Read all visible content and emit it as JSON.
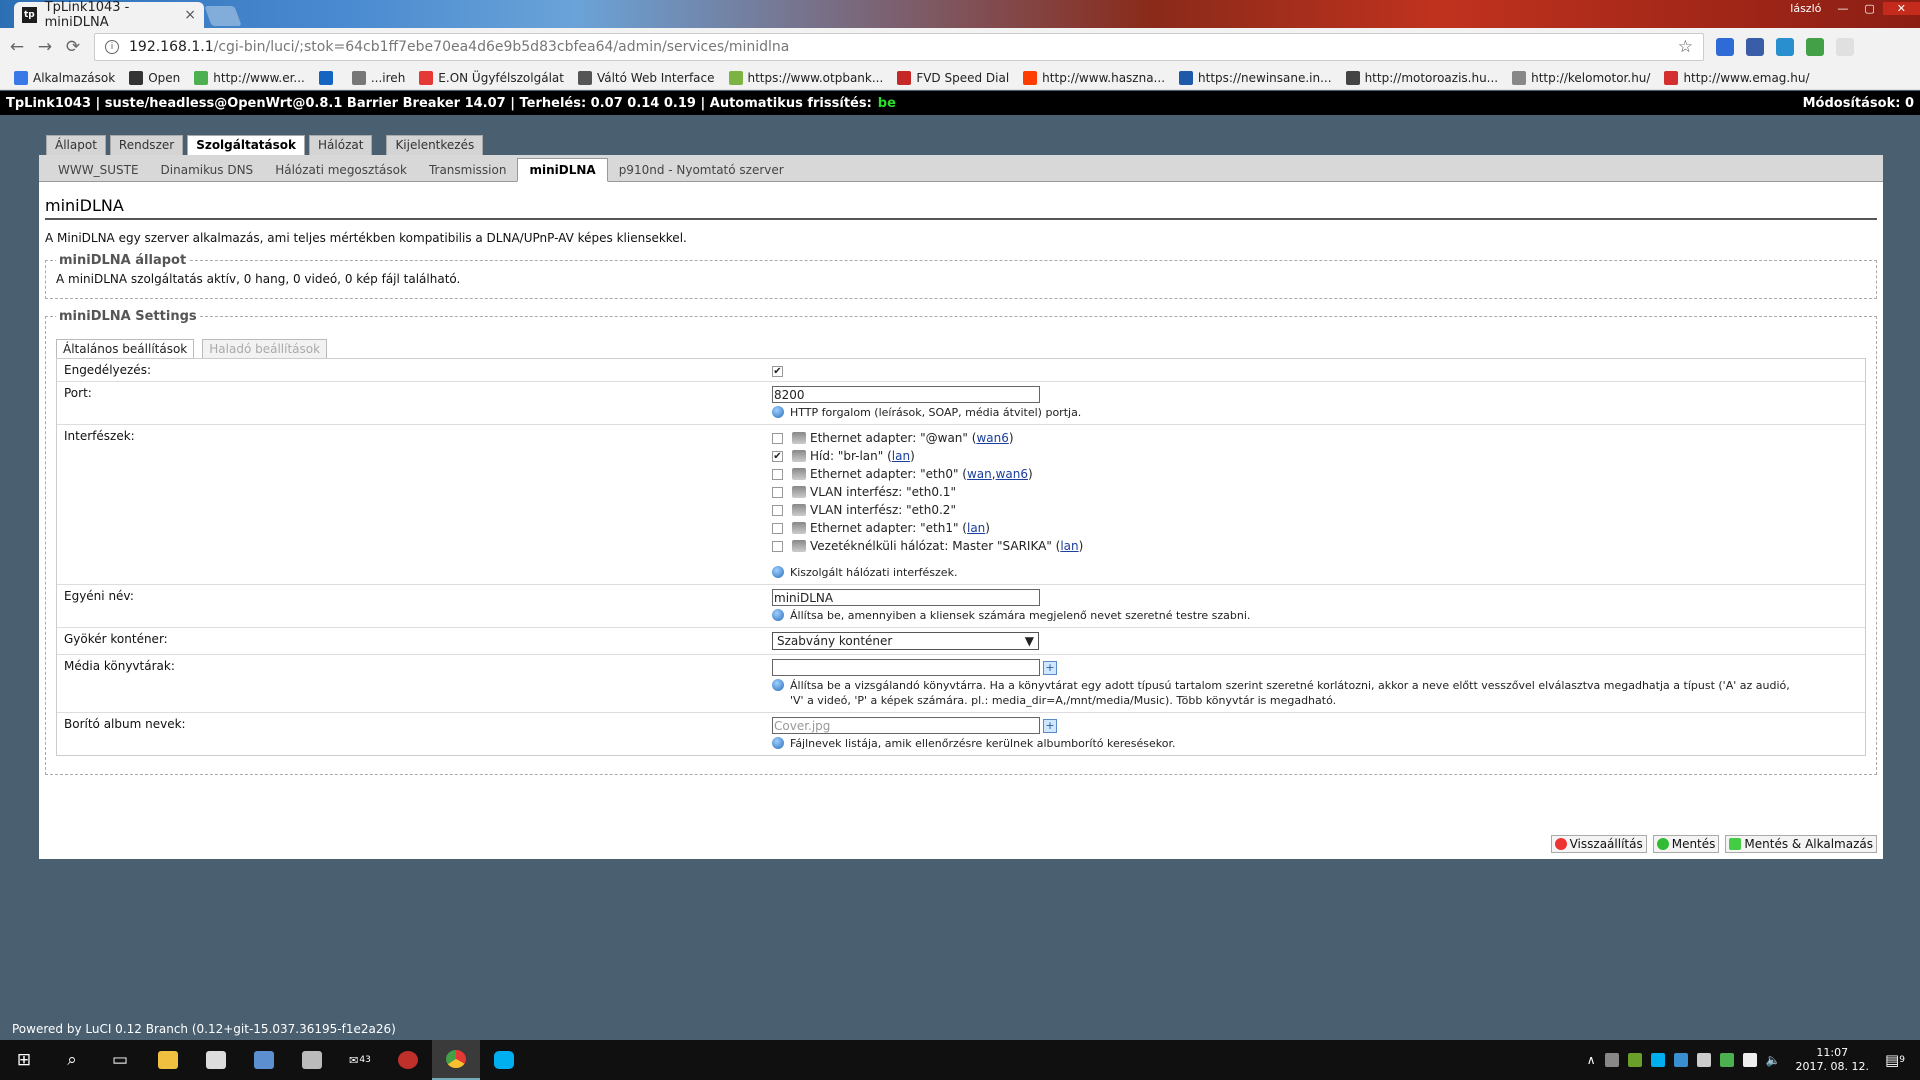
{
  "browser": {
    "tab_title": "TpLink1043 - miniDLNA",
    "tab_close": "×",
    "user_name": "lászló",
    "url_host": "192.168.1.1",
    "url_path": "/cgi-bin/luci/;stok=64cb1ff7ebe70ea4d6e9b5d83cbfea64/admin/services/minidlna",
    "star": "☆",
    "back": "←",
    "forward": "→",
    "reload": "⟳",
    "info": "i",
    "minimize": "—",
    "maximize": "▢",
    "close": "✕",
    "bookmarks": [
      {
        "label": "Alkalmazások",
        "color": "#3b78e7"
      },
      {
        "label": "Open",
        "color": "#333333"
      },
      {
        "label": "http://www.er...",
        "color": "#4caf50"
      },
      {
        "label": "",
        "color": "#1565c0"
      },
      {
        "label": "...ireh",
        "color": "#777777"
      },
      {
        "label": "E.ON Ügyfélszolgálat",
        "color": "#e53935"
      },
      {
        "label": "Váltó Web Interface",
        "color": "#555555"
      },
      {
        "label": "https://www.otpbank...",
        "color": "#7cb342"
      },
      {
        "label": "FVD Speed Dial",
        "color": "#c62828"
      },
      {
        "label": "http://www.haszna...",
        "color": "#ff3d00"
      },
      {
        "label": "https://newinsane.in...",
        "color": "#1e5aa8"
      },
      {
        "label": "http://motoroazis.hu...",
        "color": "#444444"
      },
      {
        "label": "http://kelomotor.hu/",
        "color": "#888888"
      },
      {
        "label": "http://www.emag.hu/",
        "color": "#d32f2f"
      }
    ]
  },
  "status_bar": {
    "text": "TpLink1043 | suste/headless@OpenWrt@0.8.1 Barrier Breaker 14.07 | Terhelés: 0.07 0.14 0.19 | Automatikus frissítés:",
    "refresh_state": "be",
    "changes": "Módosítások: 0"
  },
  "main_tabs": [
    "Állapot",
    "Rendszer",
    "Szolgáltatások",
    "Hálózat",
    "Kijelentkezés"
  ],
  "sub_tabs": [
    "WWW_SUSTE",
    "Dinamikus DNS",
    "Hálózati megosztások",
    "Transmission",
    "miniDLNA",
    "p910nd - Nyomtató szerver"
  ],
  "page": {
    "title": "miniDLNA",
    "description": "A MiniDLNA egy szerver alkalmazás, ami teljes mértékben kompatibilis a DLNA/UPnP-AV képes kliensekkel.",
    "status_legend": "miniDLNA állapot",
    "status_text": "A miniDLNA szolgáltatás aktív, 0 hang, 0 videó, 0 kép fájl található.",
    "settings_legend": "miniDLNA Settings",
    "tab_general": "Általános beállítások",
    "tab_advanced": "Haladó beállítások"
  },
  "form": {
    "enable_label": "Engedélyezés:",
    "enable_checked": true,
    "port_label": "Port:",
    "port_value": "8200",
    "port_hint": "HTTP forgalom (leírások, SOAP, média átvitel) portja.",
    "interfaces_label": "Interfészek:",
    "interfaces": [
      {
        "checked": false,
        "text": "Ethernet adapter: \"@wan\" (",
        "links": [
          "wan6"
        ],
        "tail": ")"
      },
      {
        "checked": true,
        "text": "Híd: \"br-lan\" (",
        "links": [
          "lan"
        ],
        "tail": ")"
      },
      {
        "checked": false,
        "text": "Ethernet adapter: \"eth0\" (",
        "links": [
          "wan",
          "wan6"
        ],
        "tail": ")"
      },
      {
        "checked": false,
        "text": "VLAN interfész: \"eth0.1\"",
        "links": [],
        "tail": ""
      },
      {
        "checked": false,
        "text": "VLAN interfész: \"eth0.2\"",
        "links": [],
        "tail": ""
      },
      {
        "checked": false,
        "text": "Ethernet adapter: \"eth1\" (",
        "links": [
          "lan"
        ],
        "tail": ")"
      },
      {
        "checked": false,
        "text": "Vezetéknélküli hálózat: Master \"SARIKA\" (",
        "links": [
          "lan"
        ],
        "tail": ")"
      }
    ],
    "interfaces_hint": "Kiszolgált hálózati interfészek.",
    "name_label": "Egyéni név:",
    "name_value": "miniDLNA",
    "name_hint": "Állítsa be, amennyiben a kliensek számára megjelenő nevet szeretné testre szabni.",
    "root_label": "Gyökér konténer:",
    "root_value": "Szabvány konténer",
    "media_label": "Média könyvtárak:",
    "media_value": "",
    "media_hint": "Állítsa be a vizsgálandó könyvtárra. Ha a könyvtárat egy adott típusú tartalom szerint szeretné korlátozni, akkor a neve előtt vesszővel elválasztva megadhatja a típust ('A' az audió, 'V' a videó, 'P' a képek számára. pl.: media_dir=A,/mnt/media/Music). Több könyvtár is megadható.",
    "cover_label": "Borító album nevek:",
    "cover_placeholder": "Cover.jpg",
    "cover_hint": "Fájlnevek listája, amik ellenőrzésre kerülnek albumborító keresésekor.",
    "plus": "+"
  },
  "actions": {
    "reset": "Visszaállítás",
    "save": "Mentés",
    "save_apply": "Mentés & Alkalmazás"
  },
  "footer": "Powered by LuCI 0.12 Branch (0.12+git-15.037.36195-f1e2a26)",
  "taskbar": {
    "mail_badge": "43",
    "time": "11:07",
    "date": "2017. 08. 12.",
    "notif_count": "9"
  }
}
